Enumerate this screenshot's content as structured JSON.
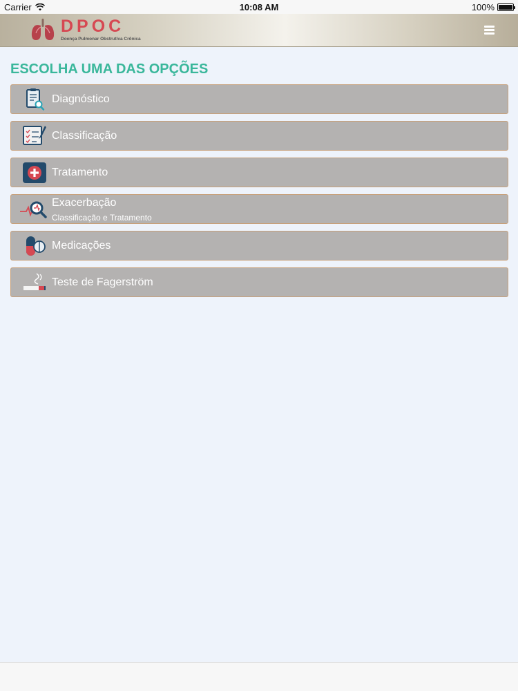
{
  "status_bar": {
    "carrier": "Carrier",
    "time": "10:08 AM",
    "battery": "100%"
  },
  "header": {
    "brand_title": "DPOC",
    "brand_subtitle": "Doença Pulmonar Obstrutiva Crônica",
    "brand_color": "#d64852",
    "menu_icon": "hamburger-menu-icon"
  },
  "main": {
    "title": "ESCOLHA UMA DAS OPÇÕES",
    "accent_color": "#3ab79b",
    "options": [
      {
        "label": "Diagnóstico",
        "icon": "clipboard-magnifier-icon"
      },
      {
        "label": "Classificação",
        "icon": "checklist-pencil-icon"
      },
      {
        "label": "Tratamento",
        "icon": "medical-cross-icon"
      },
      {
        "label": "Exacerbação",
        "sublabel": "Classificação e Tratamento",
        "icon": "heartbeat-magnifier-icon"
      },
      {
        "label": "Medicações",
        "icon": "pill-capsule-icon"
      },
      {
        "label": "Teste de Fagerström",
        "icon": "cigarette-icon"
      }
    ]
  }
}
